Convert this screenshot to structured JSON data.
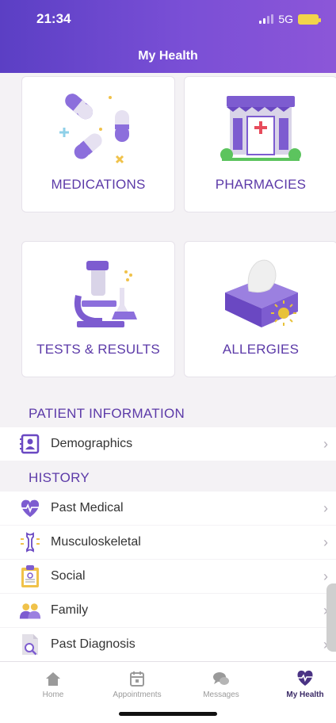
{
  "status": {
    "time": "21:34",
    "network": "5G"
  },
  "header": {
    "title": "My Health"
  },
  "tiles": [
    {
      "label": "MEDICATIONS",
      "icon": "pills-icon"
    },
    {
      "label": "PHARMACIES",
      "icon": "pharmacy-store-icon"
    },
    {
      "label": "TESTS & RESULTS",
      "icon": "microscope-icon"
    },
    {
      "label": "ALLERGIES",
      "icon": "tissue-box-icon"
    }
  ],
  "sections": {
    "patient_information": {
      "title": "PATIENT INFORMATION",
      "items": [
        {
          "label": "Demographics",
          "icon": "id-card-icon"
        }
      ]
    },
    "history": {
      "title": "HISTORY",
      "items": [
        {
          "label": "Past Medical",
          "icon": "heartbeat-icon"
        },
        {
          "label": "Musculoskeletal",
          "icon": "bone-icon"
        },
        {
          "label": "Social",
          "icon": "clipboard-icon"
        },
        {
          "label": "Family",
          "icon": "family-icon"
        },
        {
          "label": "Past Diagnosis",
          "icon": "document-search-icon"
        }
      ]
    }
  },
  "tabbar": [
    {
      "label": "Home",
      "icon": "home-icon"
    },
    {
      "label": "Appointments",
      "icon": "calendar-icon"
    },
    {
      "label": "Messages",
      "icon": "chat-icon"
    },
    {
      "label": "My Health",
      "icon": "heart-pulse-icon"
    }
  ],
  "colors": {
    "primary": "#5c3aa8",
    "header_start": "#5b3fc4",
    "header_end": "#8c56d8"
  }
}
